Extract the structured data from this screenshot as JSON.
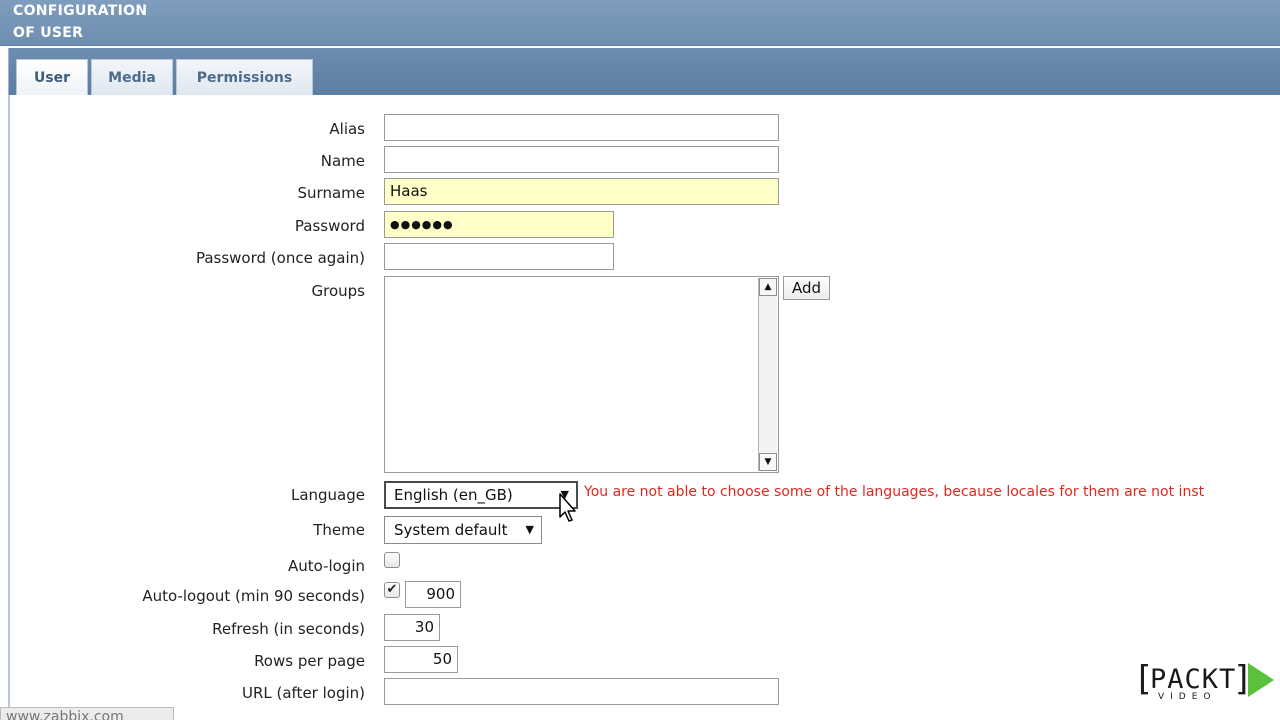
{
  "header": {
    "title_line1": "CONFIGURATION",
    "title_line2": "OF USER"
  },
  "tabs": [
    {
      "label": "User",
      "active": true
    },
    {
      "label": "Media"
    },
    {
      "label": "Permissions"
    }
  ],
  "form": {
    "alias": {
      "label": "Alias",
      "value": ""
    },
    "name": {
      "label": "Name",
      "value": ""
    },
    "surname": {
      "label": "Surname",
      "value": "Haas"
    },
    "password": {
      "label": "Password",
      "value": "●●●●●●"
    },
    "password_again": {
      "label": "Password (once again)",
      "value": ""
    },
    "groups": {
      "label": "Groups",
      "add_label": "Add"
    },
    "language": {
      "label": "Language",
      "selected": "English (en_GB)",
      "error": "You are not able to choose some of the languages, because locales for them are not inst"
    },
    "theme": {
      "label": "Theme",
      "selected": "System default"
    },
    "auto_login": {
      "label": "Auto-login",
      "checked": false
    },
    "auto_logout": {
      "label": "Auto-logout (min 90 seconds)",
      "checked": true,
      "value": "900"
    },
    "refresh": {
      "label": "Refresh (in seconds)",
      "value": "30"
    },
    "rows_per_page": {
      "label": "Rows per page",
      "value": "50"
    },
    "url": {
      "label": "URL (after login)",
      "value": ""
    }
  },
  "status_bar": {
    "url": "www.zabbix.com"
  },
  "watermark": {
    "brand": "PACKT",
    "sub": "VIDEO"
  },
  "colors": {
    "header": "#6f8fb1",
    "error": "#e0271f",
    "highlight": "#ffffc8",
    "play": "#5cc13a"
  }
}
